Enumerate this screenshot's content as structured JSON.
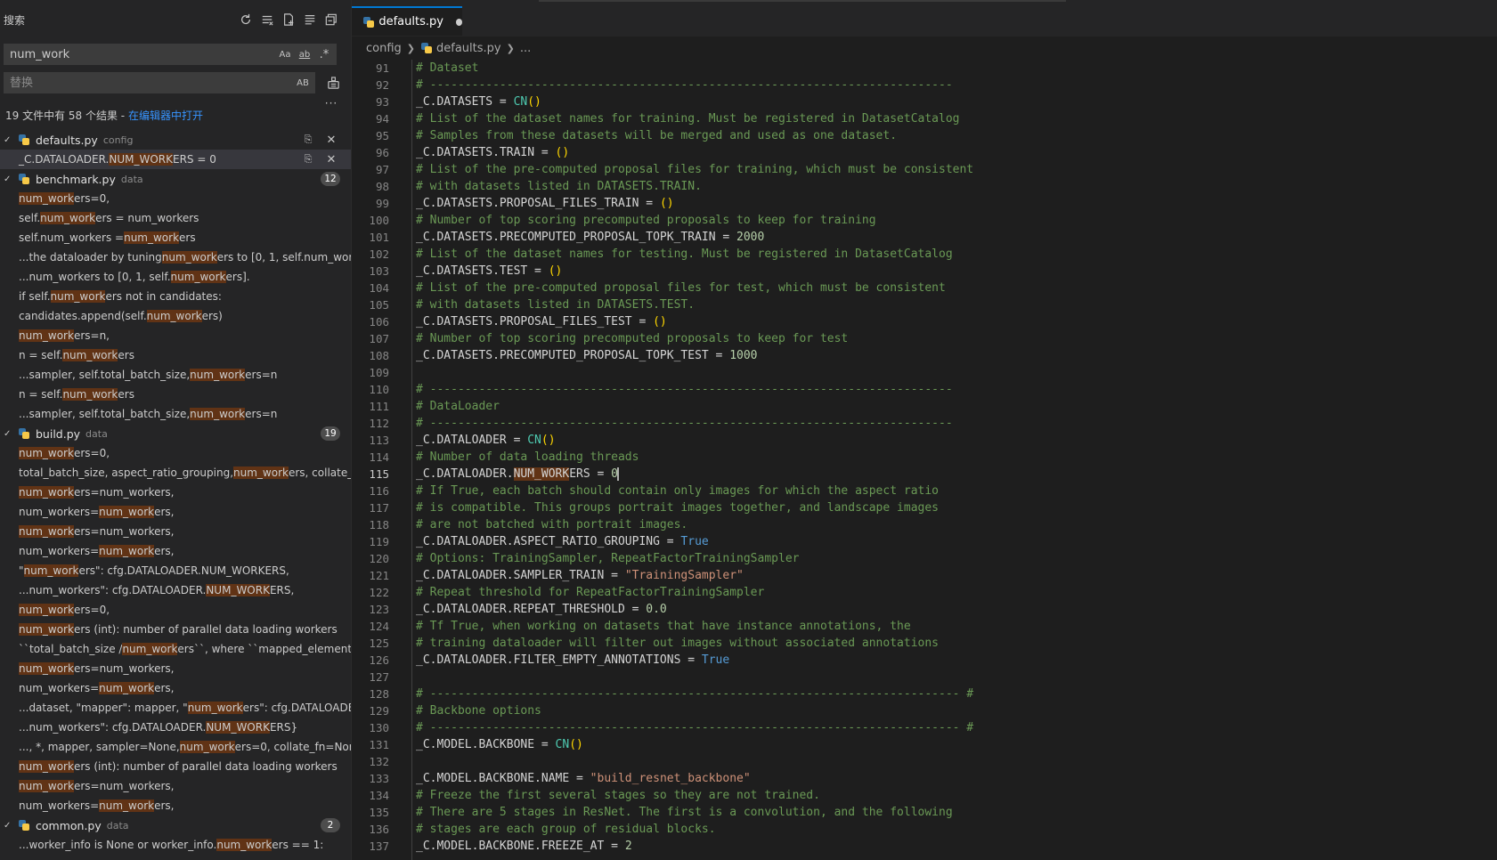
{
  "sidebar": {
    "title": "搜索",
    "find": {
      "value": "num_work",
      "opt_case": "Aa",
      "opt_word": "ab",
      "opt_regex": ".*"
    },
    "replace": {
      "placeholder": "替换",
      "opt_preserve": "AB"
    },
    "summary": {
      "text": "19 文件中有 58 个结果 - ",
      "link": "在编辑器中打开"
    },
    "files": [
      {
        "name": "defaults.py",
        "dir": "config",
        "count": "",
        "matches": [
          {
            "pre": "_C.DATALOADER.",
            "hit": "NUM_WORK",
            "post": "ERS = 0",
            "selected": true
          }
        ]
      },
      {
        "name": "benchmark.py",
        "dir": "data",
        "count": "12",
        "matches": [
          {
            "pre": "",
            "hit": "num_work",
            "post": "ers=0,"
          },
          {
            "pre": "self.",
            "hit": "num_work",
            "post": "ers = num_workers"
          },
          {
            "pre": "self.num_workers = ",
            "hit": "num_work",
            "post": "ers"
          },
          {
            "pre": "...the dataloader by tuning ",
            "hit": "num_work",
            "post": "ers to [0, 1, self.num_work..."
          },
          {
            "pre": "...num_workers to [0, 1, self.",
            "hit": "num_work",
            "post": "ers]."
          },
          {
            "pre": "if self.",
            "hit": "num_work",
            "post": "ers not in candidates:"
          },
          {
            "pre": "candidates.append(self.",
            "hit": "num_work",
            "post": "ers)"
          },
          {
            "pre": "",
            "hit": "num_work",
            "post": "ers=n,"
          },
          {
            "pre": "n = self.",
            "hit": "num_work",
            "post": "ers"
          },
          {
            "pre": "...sampler, self.total_batch_size, ",
            "hit": "num_work",
            "post": "ers=n"
          },
          {
            "pre": "n = self.",
            "hit": "num_work",
            "post": "ers"
          },
          {
            "pre": "...sampler, self.total_batch_size, ",
            "hit": "num_work",
            "post": "ers=n"
          }
        ]
      },
      {
        "name": "build.py",
        "dir": "data",
        "count": "19",
        "matches": [
          {
            "pre": "",
            "hit": "num_work",
            "post": "ers=0,"
          },
          {
            "pre": "total_batch_size, aspect_ratio_grouping, ",
            "hit": "num_work",
            "post": "ers, collate_f..."
          },
          {
            "pre": "",
            "hit": "num_work",
            "post": "ers=num_workers,"
          },
          {
            "pre": "num_workers=",
            "hit": "num_work",
            "post": "ers,"
          },
          {
            "pre": "",
            "hit": "num_work",
            "post": "ers=num_workers,"
          },
          {
            "pre": "num_workers=",
            "hit": "num_work",
            "post": "ers,"
          },
          {
            "pre": "\"",
            "hit": "num_work",
            "post": "ers\": cfg.DATALOADER.NUM_WORKERS,"
          },
          {
            "pre": "...num_workers\": cfg.DATALOADER.",
            "hit": "NUM_WORK",
            "post": "ERS,"
          },
          {
            "pre": "",
            "hit": "num_work",
            "post": "ers=0,"
          },
          {
            "pre": "",
            "hit": "num_work",
            "post": "ers (int): number of parallel data loading workers"
          },
          {
            "pre": "``total_batch_size / ",
            "hit": "num_work",
            "post": "ers``, where ``mapped_element`` is..."
          },
          {
            "pre": "",
            "hit": "num_work",
            "post": "ers=num_workers,"
          },
          {
            "pre": "num_workers=",
            "hit": "num_work",
            "post": "ers,"
          },
          {
            "pre": "...dataset, \"mapper\": mapper, \"",
            "hit": "num_work",
            "post": "ers\": cfg.DATALOADER..."
          },
          {
            "pre": "...num_workers\": cfg.DATALOADER.",
            "hit": "NUM_WORK",
            "post": "ERS}"
          },
          {
            "pre": "..., *, mapper, sampler=None, ",
            "hit": "num_work",
            "post": "ers=0, collate_fn=None):"
          },
          {
            "pre": "",
            "hit": "num_work",
            "post": "ers (int): number of parallel data loading workers"
          },
          {
            "pre": "",
            "hit": "num_work",
            "post": "ers=num_workers,"
          },
          {
            "pre": "num_workers=",
            "hit": "num_work",
            "post": "ers,"
          }
        ]
      },
      {
        "name": "common.py",
        "dir": "data",
        "count": "2",
        "matches": [
          {
            "pre": "...worker_info is None or worker_info.",
            "hit": "num_work",
            "post": "ers == 1:"
          }
        ]
      }
    ]
  },
  "editor": {
    "tab": {
      "label": "defaults.py"
    },
    "breadcrumb": {
      "folder": "config",
      "file": "defaults.py",
      "more": "..."
    },
    "active_line": 115,
    "lines": [
      {
        "n": "91",
        "t": "# Dataset"
      },
      {
        "n": "92",
        "t": "# ---------------------------------------------------------------------------"
      },
      {
        "n": "93",
        "t": "_C.DATASETS = CN()"
      },
      {
        "n": "94",
        "t": "# List of the dataset names for training. Must be registered in DatasetCatalog"
      },
      {
        "n": "95",
        "t": "# Samples from these datasets will be merged and used as one dataset."
      },
      {
        "n": "96",
        "t": "_C.DATASETS.TRAIN = ()"
      },
      {
        "n": "97",
        "t": "# List of the pre-computed proposal files for training, which must be consistent"
      },
      {
        "n": "98",
        "t": "# with datasets listed in DATASETS.TRAIN."
      },
      {
        "n": "99",
        "t": "_C.DATASETS.PROPOSAL_FILES_TRAIN = ()"
      },
      {
        "n": "100",
        "t": "# Number of top scoring precomputed proposals to keep for training"
      },
      {
        "n": "101",
        "t": "_C.DATASETS.PRECOMPUTED_PROPOSAL_TOPK_TRAIN = 2000"
      },
      {
        "n": "102",
        "t": "# List of the dataset names for testing. Must be registered in DatasetCatalog"
      },
      {
        "n": "103",
        "t": "_C.DATASETS.TEST = ()"
      },
      {
        "n": "104",
        "t": "# List of the pre-computed proposal files for test, which must be consistent"
      },
      {
        "n": "105",
        "t": "# with datasets listed in DATASETS.TEST."
      },
      {
        "n": "106",
        "t": "_C.DATASETS.PROPOSAL_FILES_TEST = ()"
      },
      {
        "n": "107",
        "t": "# Number of top scoring precomputed proposals to keep for test"
      },
      {
        "n": "108",
        "t": "_C.DATASETS.PRECOMPUTED_PROPOSAL_TOPK_TEST = 1000"
      },
      {
        "n": "109",
        "t": ""
      },
      {
        "n": "110",
        "t": "# ---------------------------------------------------------------------------"
      },
      {
        "n": "111",
        "t": "# DataLoader"
      },
      {
        "n": "112",
        "t": "# ---------------------------------------------------------------------------"
      },
      {
        "n": "113",
        "t": "_C.DATALOADER = CN()"
      },
      {
        "n": "114",
        "t": "# Number of data loading threads"
      },
      {
        "n": "115",
        "t": "_C.DATALOADER.NUM_WORKERS = 0"
      },
      {
        "n": "116",
        "t": "# If True, each batch should contain only images for which the aspect ratio"
      },
      {
        "n": "117",
        "t": "# is compatible. This groups portrait images together, and landscape images"
      },
      {
        "n": "118",
        "t": "# are not batched with portrait images."
      },
      {
        "n": "119",
        "t": "_C.DATALOADER.ASPECT_RATIO_GROUPING = True"
      },
      {
        "n": "120",
        "t": "# Options: TrainingSampler, RepeatFactorTrainingSampler"
      },
      {
        "n": "121",
        "t": "_C.DATALOADER.SAMPLER_TRAIN = \"TrainingSampler\""
      },
      {
        "n": "122",
        "t": "# Repeat threshold for RepeatFactorTrainingSampler"
      },
      {
        "n": "123",
        "t": "_C.DATALOADER.REPEAT_THRESHOLD = 0.0"
      },
      {
        "n": "124",
        "t": "# Tf True, when working on datasets that have instance annotations, the"
      },
      {
        "n": "125",
        "t": "# training dataloader will filter out images without associated annotations"
      },
      {
        "n": "126",
        "t": "_C.DATALOADER.FILTER_EMPTY_ANNOTATIONS = True"
      },
      {
        "n": "127",
        "t": ""
      },
      {
        "n": "128",
        "t": "# ---------------------------------------------------------------------------- #"
      },
      {
        "n": "129",
        "t": "# Backbone options"
      },
      {
        "n": "130",
        "t": "# ---------------------------------------------------------------------------- #"
      },
      {
        "n": "131",
        "t": "_C.MODEL.BACKBONE = CN()"
      },
      {
        "n": "132",
        "t": ""
      },
      {
        "n": "133",
        "t": "_C.MODEL.BACKBONE.NAME = \"build_resnet_backbone\""
      },
      {
        "n": "134",
        "t": "# Freeze the first several stages so they are not trained."
      },
      {
        "n": "135",
        "t": "# There are 5 stages in ResNet. The first is a convolution, and the following"
      },
      {
        "n": "136",
        "t": "# stages are each group of residual blocks."
      },
      {
        "n": "137",
        "t": "_C.MODEL.BACKBONE.FREEZE_AT = 2"
      }
    ]
  }
}
